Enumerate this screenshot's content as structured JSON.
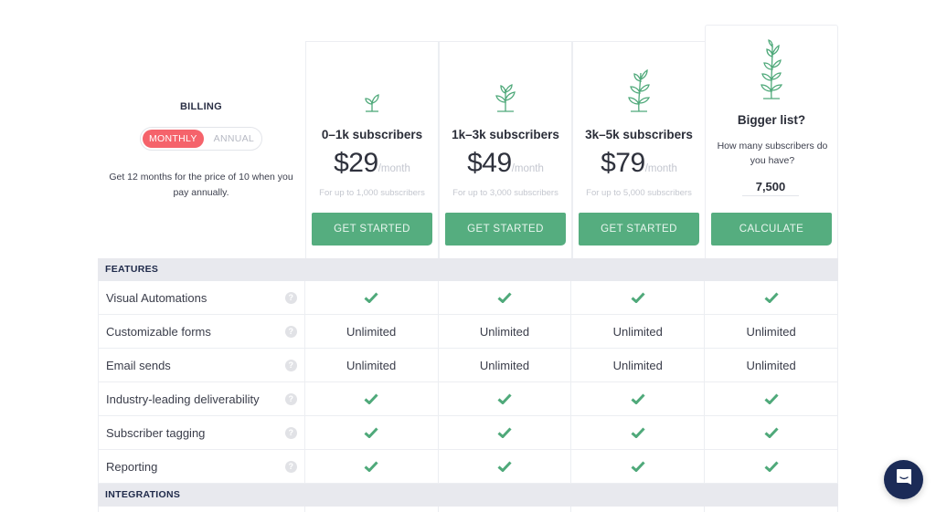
{
  "billing": {
    "title": "BILLING",
    "options": [
      "MONTHLY",
      "ANNUAL"
    ],
    "selected": "MONTHLY",
    "note": "Get 12 months for the price of 10 when you pay annually."
  },
  "plans": [
    {
      "name": "0–1k subscribers",
      "price": "$29",
      "period": "/month",
      "sub": "For up to 1,000 subscribers",
      "cta": "GET STARTED",
      "icon": "sprout-small-icon"
    },
    {
      "name": "1k–3k subscribers",
      "price": "$49",
      "period": "/month",
      "sub": "For up to 3,000 subscribers",
      "cta": "GET STARTED",
      "icon": "sprout-medium-icon"
    },
    {
      "name": "3k–5k subscribers",
      "price": "$79",
      "period": "/month",
      "sub": "For up to 5,000 subscribers",
      "cta": "GET STARTED",
      "icon": "plant-large-icon"
    }
  ],
  "bigger": {
    "title": "Bigger list?",
    "question": "How many subscribers do you have?",
    "value": "7,500",
    "cta": "CALCULATE",
    "icon": "plant-tall-icon"
  },
  "table": {
    "sections": [
      {
        "title": "FEATURES",
        "rows": [
          {
            "label": "Visual Automations",
            "values": [
              "check",
              "check",
              "check",
              "check"
            ]
          },
          {
            "label": "Customizable forms",
            "values": [
              "Unlimited",
              "Unlimited",
              "Unlimited",
              "Unlimited"
            ]
          },
          {
            "label": "Email sends",
            "values": [
              "Unlimited",
              "Unlimited",
              "Unlimited",
              "Unlimited"
            ]
          },
          {
            "label": "Industry-leading deliverability",
            "values": [
              "check",
              "check",
              "check",
              "check"
            ]
          },
          {
            "label": "Subscriber tagging",
            "values": [
              "check",
              "check",
              "check",
              "check"
            ]
          },
          {
            "label": "Reporting",
            "values": [
              "check",
              "check",
              "check",
              "check"
            ]
          }
        ]
      },
      {
        "title": "INTEGRATIONS",
        "rows": []
      }
    ],
    "help_glyph": "?"
  },
  "colors": {
    "accent_green": "#55ad7f",
    "toggle_active": "#f5636b",
    "chat_button": "#1b2b57",
    "section_bg": "#e8e9ee"
  },
  "chat": {
    "icon": "chat-icon"
  }
}
